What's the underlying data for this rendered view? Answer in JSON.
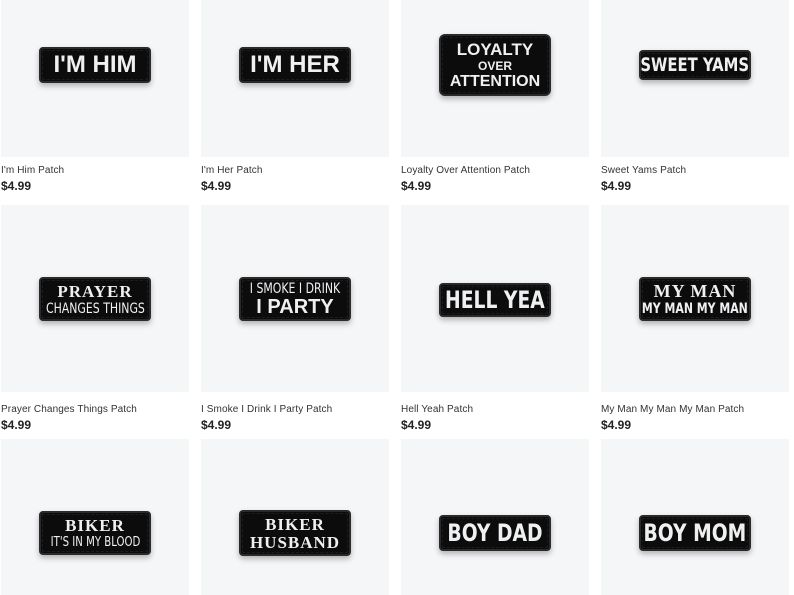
{
  "products": [
    {
      "title": "I'm Him Patch",
      "price": "$4.99",
      "patch_lines": [
        "I'M HIM"
      ]
    },
    {
      "title": "I'm Her Patch",
      "price": "$4.99",
      "patch_lines": [
        "I'M HER"
      ]
    },
    {
      "title": "Loyalty Over Attention Patch",
      "price": "$4.99",
      "patch_lines": [
        "LOYALTY",
        "OVER",
        "ATTENTION"
      ]
    },
    {
      "title": "Sweet Yams Patch",
      "price": "$4.99",
      "patch_lines": [
        "SWEET YAMS"
      ]
    },
    {
      "title": "Prayer Changes Things Patch",
      "price": "$4.99",
      "patch_lines": [
        "PRAYER",
        "CHANGES THINGS"
      ]
    },
    {
      "title": "I Smoke I Drink I Party Patch",
      "price": "$4.99",
      "patch_lines": [
        "I SMOKE I DRINK",
        "I PARTY"
      ]
    },
    {
      "title": "Hell Yeah Patch",
      "price": "$4.99",
      "patch_lines": [
        "HELL YEA"
      ]
    },
    {
      "title": "My Man My Man My Man Patch",
      "price": "$4.99",
      "patch_lines": [
        "MY MAN",
        "MY MAN MY MAN"
      ]
    },
    {
      "title": "",
      "price": "",
      "patch_lines": [
        "BIKER",
        "IT'S IN MY BLOOD"
      ]
    },
    {
      "title": "",
      "price": "",
      "patch_lines": [
        "BIKER",
        "HUSBAND"
      ]
    },
    {
      "title": "",
      "price": "",
      "patch_lines": [
        "BOY DAD"
      ]
    },
    {
      "title": "",
      "price": "",
      "patch_lines": [
        "BOY MOM"
      ]
    }
  ],
  "colors": {
    "card_bg": "#f5f6f8",
    "patch_bg": "#0c0c0c",
    "patch_text": "#eef0f2"
  }
}
